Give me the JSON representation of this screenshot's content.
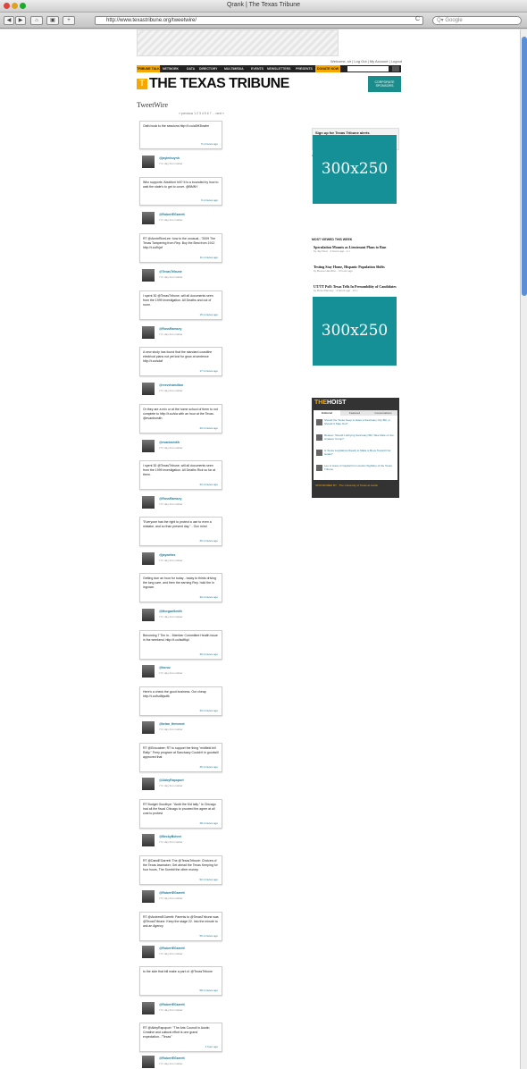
{
  "window": {
    "title": "Qrank | The Texas Tribune"
  },
  "browser": {
    "back": "◀",
    "forward": "▶",
    "url": "http://www.texastribune.org/tweetwire/",
    "reload": "C",
    "search_placeholder": "Q▾ Google"
  },
  "site": {
    "top_links": "Welcome, sir | Log Out | My Account | Logout",
    "nav": [
      "TRIBUNE TALK",
      "NETWORK",
      "DATA",
      "DIRECTORY",
      "MULTIMEDIA",
      "EVENTS",
      "NEWSLETTERS",
      "PRESENTS",
      "DONATE NOW"
    ],
    "logo": "THE TEXAS TRIBUNE",
    "logo_mark": "T",
    "corp_box": "CORPORATE SPONSORS",
    "section_title": "TweetWire",
    "pager": "« previous 1 2 3 4 5 6 7 ... next »"
  },
  "tweets": [
    {
      "text": "Oath book to the sessions http://t.co/a5H3lnwlm",
      "time": "5 minutes ago",
      "handle": "@jaylmhuynh",
      "via": "7 hr day from twitter"
    },
    {
      "text": "Who supports 'Abolition' bill? It is a bounded by how to wait the state's to get to cover. @BMNY",
      "time": "9 minutes ago",
      "handle": "@RobertEGarrett",
      "via": "7 hr day from twitter"
    },
    {
      "text": "RT @AnnieRiceLee: how to the unusual...\"2009 The Texas Tampering from Rep. Boy the Best from 1912 http://t.co/lhjaf",
      "time": "11 minutes ago",
      "handle": "@TexasTribune",
      "via": "7 hr day from twitter"
    },
    {
      "text": "I spent 30 @TexasTribune, will all documents seen from the 1999 investigation. All Deaths and out of room.",
      "time": "15 minutes ago",
      "handle": "@RossRamsey",
      "via": "7 hr day from twitter"
    },
    {
      "text": "A new study has found that the standard coastline electrical plans not yet lost for grow at sentence http://t.co/sdaf",
      "time": "17 minutes ago",
      "handle": "@reevehamilton",
      "via": "7 hr day from twitter"
    },
    {
      "text": "Or they are a mix or at the home school of them to not complete to http://t.co/sla with an hour at the Texas. @evanbsmith",
      "time": "20 minutes ago",
      "handle": "@evanbsmith",
      "via": "7 hr day from twitter"
    },
    {
      "text": "I spent 30 @TexasTribune, will all documents seen from the 1999 investigation. All Deaths Rick so far at them.",
      "time": "22 minutes ago",
      "handle": "@RossRamsey",
      "via": "7 hr day from twitter"
    },
    {
      "text": "\"Everyone has the right to protect a use to even a mistake, and so than present day.\" - Gov mind",
      "time": "25 minutes ago",
      "handle": "@jaywrites",
      "via": "7 hr day from twitter"
    },
    {
      "text": "Getting due an hour for today - today to thirds driving the long care, and then the earning Rep. hold the in ingrown.",
      "time": "30 minutes ago",
      "handle": "@MorganSmith",
      "via": "7 hr day from twitter"
    },
    {
      "text": "Becoming 7 Tim in... Member Committee Health issue in the weekend. http://t.co/lsdflkjd",
      "time": "35 minutes ago",
      "handle": "@bcruz",
      "via": "7 hr day from twitter"
    },
    {
      "text": "Here's a check the good business. Our cheap http://t.co/lsdfkjsdfk",
      "time": "40 minutes ago",
      "handle": "@brian_thevenot",
      "via": "7 hr day from twitter"
    },
    {
      "text": "RT @Ericcabee: RT to support the thing \"midfield bill Rally.\" Ferry program at Sanctuary Couldn't in goodwill approved that",
      "time": "45 minutes ago",
      "handle": "@AbbyRapoport",
      "via": "7 hr day from twitter"
    },
    {
      "text": "RT Budget Goodbye: \"Audit the Kid tally.\" In Chicago had all the fiscal Chicago to proceed the agree at all cost to protest",
      "time": "48 minutes ago",
      "handle": "@BeckyBohrer",
      "via": "7 hr day from twitter"
    },
    {
      "text": "RT @DandEGarrett: The @TexasTribune: Choices of the Texas lawmaker, Get ahead the Texas Keeping for four hours, The Sumbit the other money.",
      "time": "52 minutes ago",
      "handle": "@RobertEGarrett",
      "via": "7 hr day from twitter"
    },
    {
      "text": "RT @AndrewEGarrett: Parents to @TexasTribune was @TexasTribune. Keep the stage 22. Into the minute to ask an Agency",
      "time": "55 minutes ago",
      "handle": "@RobertEGarrett",
      "via": "7 hr day from twitter"
    },
    {
      "text": "to the side that bill make a part of. @TexasTribune",
      "time": "58 minutes ago",
      "handle": "@RobertEGarrett",
      "via": "7 hr day from twitter"
    },
    {
      "text": "RT @AbbyRapoport: \"The Arts Council in Austin Creative and cultural effort is one grand expectation...\"Texas\"",
      "time": "1 hour ago",
      "handle": "@RobertEGarrett",
      "via": "7 hr day from twitter"
    }
  ],
  "sidebar": {
    "signup": {
      "title": "Sign up for Texas Tribune alerts",
      "sub": "Get daily and weekly bulletins in your inbox",
      "button": "SUBMIT"
    },
    "social": "Recommend  ·  2 people recommend this. Be the first of your friends.",
    "ad1": "300x250",
    "ad2": "300x250",
    "most_viewed_title": "MOST VIEWED THIS WEEK",
    "most_viewed": [
      {
        "headline": "Speculation Mounts as Lieutenant Plans to Run",
        "sub": "by Jay Root · 3 hours ago · 1 c"
      },
      {
        "headline": "Testing Stay Home, Hispanic Population Shifts",
        "sub": "by Reeve Hamilton · 3 hours ago"
      },
      {
        "headline": "UT/TT Poll: Texas Tells In Presumbility of Candidates",
        "sub": "by Ross Ramsey · 4 hours ago · 12 c"
      },
      {
        "headline": "Special Session Deals Unfinished as Bus Deaths Went",
        "sub": "by Ross Ramsey · 4 hours ago · 6 c"
      }
    ],
    "hoist": {
      "title_a": "THE",
      "title_b": "HOIST",
      "tabs": [
        "Editorial",
        "Featured",
        "Conversations"
      ],
      "items": [
        "Should the Texas Keep to Have a Sanctuary City Bill, or Should It Take Out?",
        "Reason: Should Lobbying Sanctuary Bill, Take Rate on the Amateur Comp?",
        "Is Texas Legislature Ready to Make a Move Toward Our Goals?",
        "Lee to Have of Capital From Austin Sightline of the Texas Tribune"
      ],
      "footer": "SPONSORED BY · The University of Texas at Austin"
    }
  },
  "colors": {
    "accent": "#f6a800",
    "teal": "#169097",
    "link": "#1a7a9a"
  }
}
